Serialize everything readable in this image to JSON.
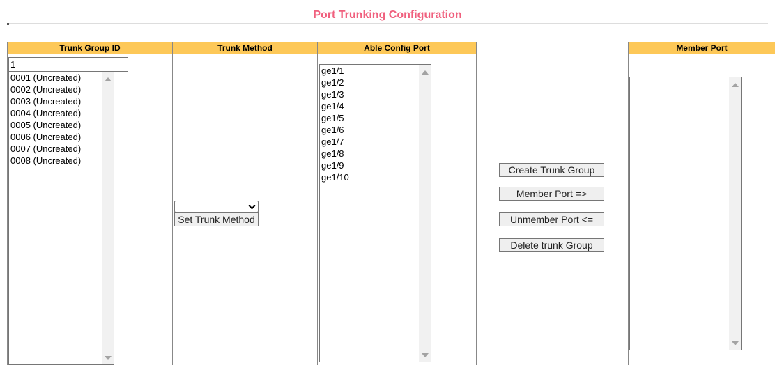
{
  "page": {
    "title": "Port Trunking Configuration"
  },
  "colors": {
    "title": "#f0607e",
    "header_bg": "#fdc858"
  },
  "trunk_group": {
    "header": "Trunk Group ID",
    "input_value": "1",
    "options": [
      "0001 (Uncreated)",
      "0002 (Uncreated)",
      "0003 (Uncreated)",
      "0004 (Uncreated)",
      "0005 (Uncreated)",
      "0006 (Uncreated)",
      "0007 (Uncreated)",
      "0008 (Uncreated)"
    ]
  },
  "trunk_method": {
    "header": "Trunk Method",
    "selected": "",
    "set_button": "Set Trunk Method"
  },
  "able_config": {
    "header": "Able Config Port",
    "options": [
      "ge1/1",
      "ge1/2",
      "ge1/3",
      "ge1/4",
      "ge1/5",
      "ge1/6",
      "ge1/7",
      "ge1/8",
      "ge1/9",
      "ge1/10"
    ]
  },
  "actions": {
    "create": "Create Trunk Group",
    "member": "Member Port =>",
    "unmember": "Unmember Port <=",
    "delete": "Delete trunk Group"
  },
  "member_port": {
    "header": "Member Port",
    "options": []
  }
}
